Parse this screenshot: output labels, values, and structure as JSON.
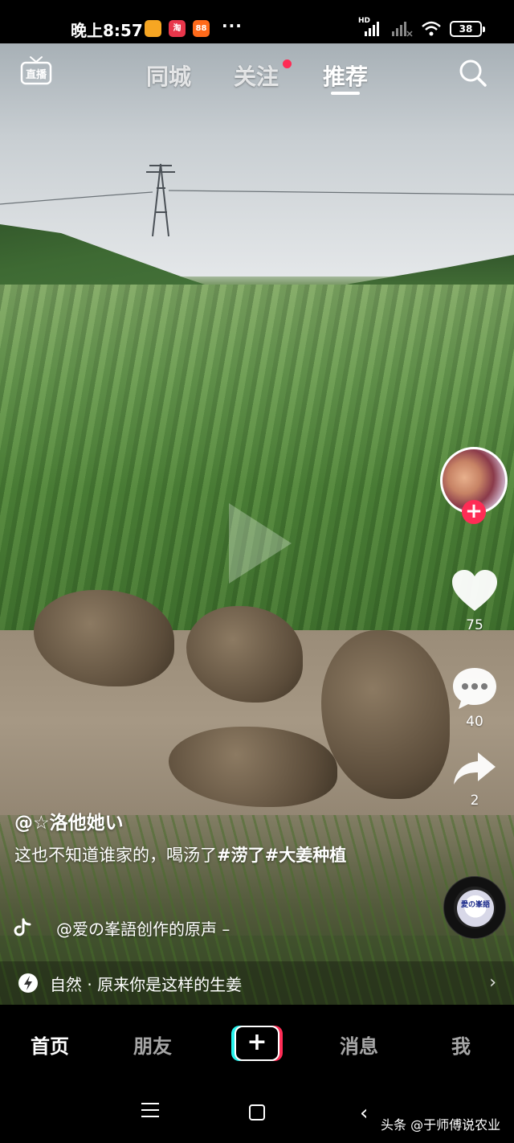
{
  "status_bar": {
    "time": "晚上8:57",
    "app_icons": [
      "pictures-app-icon",
      "taobao-app-icon",
      "meituan-app-icon"
    ],
    "app_icon_labels": [
      "",
      "淘",
      "88"
    ],
    "more": "···",
    "network": "HD",
    "battery": "38"
  },
  "top_nav": {
    "live_label": "直播",
    "tabs": [
      "同城",
      "关注",
      "推荐"
    ],
    "active_tab": "推荐"
  },
  "video": {
    "author": "@☆洛他她い",
    "caption_text": "这也不知道谁家的，喝汤了",
    "hashtags": [
      "#涝了",
      "#大姜种植"
    ],
    "music": "@爱の峯語创作的原声 –",
    "disc_text": "愛の峯語"
  },
  "actions": {
    "likes": "75",
    "comments": "40",
    "shares": "2"
  },
  "topic_bar": {
    "text": "自然 · 原来你是这样的生姜"
  },
  "bottom_tabs": {
    "home": "首页",
    "friends": "朋友",
    "create": "+",
    "messages": "消息",
    "me": "我"
  },
  "system_nav": {
    "watermark": "头条 @于师傅说农业"
  },
  "colors": {
    "accent_red": "#fe2c55",
    "accent_cyan": "#25f4ee",
    "background": "#000000"
  }
}
